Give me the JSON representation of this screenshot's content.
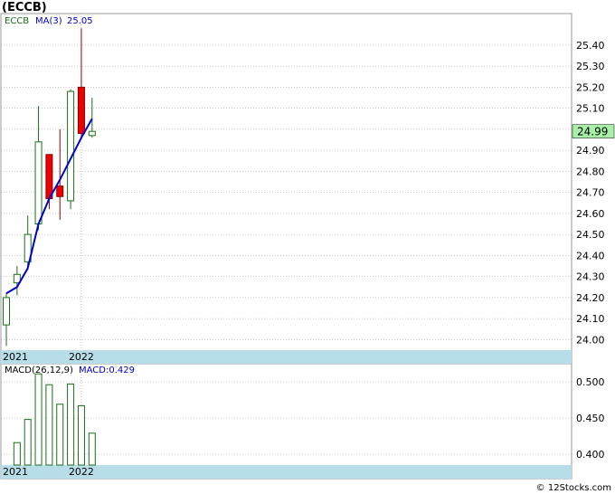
{
  "page": {
    "title": "(ECCB)",
    "copyright": "© 12Stocks.com"
  },
  "colors": {
    "up": "#1a6e1a",
    "down_fill": "#ee0000",
    "down_wick": "#8b0000",
    "ma_line": "#0000cc",
    "macd_bar": "#1a6e1a",
    "grid": "#9a9a9a",
    "axis_band": "#b7dde8",
    "price_tag_bg": "#a8f0a8"
  },
  "chart_data": [
    {
      "type": "candlestick",
      "title": "(ECCB)",
      "legend": {
        "symbol": "ECCB",
        "ma_label": "MA(3)",
        "ma_value": "25.05"
      },
      "ylim": [
        23.95,
        25.55
      ],
      "yticks": [
        24.0,
        24.1,
        24.2,
        24.3,
        24.4,
        24.5,
        24.6,
        24.7,
        24.8,
        24.9,
        25.0,
        25.1,
        25.2,
        25.3,
        25.4
      ],
      "ytick_labels": [
        "24.00",
        "24.10",
        "24.20",
        "24.30",
        "24.40",
        "24.50",
        "24.60",
        "24.70",
        "24.80",
        "24.90",
        "25.00",
        "25.10",
        "25.20",
        "25.30",
        "25.40"
      ],
      "x_labels": [
        {
          "label": "2021",
          "index": 0
        },
        {
          "label": "2022",
          "index": 7
        }
      ],
      "candles": [
        {
          "open": 24.07,
          "high": 24.22,
          "low": 23.97,
          "close": 24.2
        },
        {
          "open": 24.27,
          "high": 24.35,
          "low": 24.21,
          "close": 24.31
        },
        {
          "open": 24.37,
          "high": 24.59,
          "low": 24.33,
          "close": 24.5
        },
        {
          "open": 24.55,
          "high": 25.11,
          "low": 24.52,
          "close": 24.94
        },
        {
          "open": 24.88,
          "high": 24.88,
          "low": 24.62,
          "close": 24.67
        },
        {
          "open": 24.73,
          "high": 25.0,
          "low": 24.57,
          "close": 24.68
        },
        {
          "open": 24.66,
          "high": 25.19,
          "low": 24.62,
          "close": 25.18
        },
        {
          "open": 25.2,
          "high": 25.48,
          "low": 24.95,
          "close": 24.98
        },
        {
          "open": 24.97,
          "high": 25.15,
          "low": 24.96,
          "close": 24.99
        }
      ],
      "ma3": [
        24.22,
        24.25,
        24.34,
        24.55,
        24.67,
        24.76,
        24.86,
        24.96,
        25.05
      ],
      "last_price": "24.99"
    },
    {
      "type": "bar",
      "legend": {
        "label": "MACD(26,12,9)",
        "value_label": "MACD:0.429"
      },
      "ylim": [
        0.385,
        0.525
      ],
      "yticks": [
        0.4,
        0.45,
        0.5
      ],
      "ytick_labels": [
        "0.400",
        "0.450",
        "0.500"
      ],
      "x_labels": [
        {
          "label": "2021",
          "index": 0
        },
        {
          "label": "2022",
          "index": 7
        }
      ],
      "values": [
        0.385,
        0.416,
        0.448,
        0.511,
        0.496,
        0.469,
        0.497,
        0.467,
        0.429
      ]
    }
  ]
}
